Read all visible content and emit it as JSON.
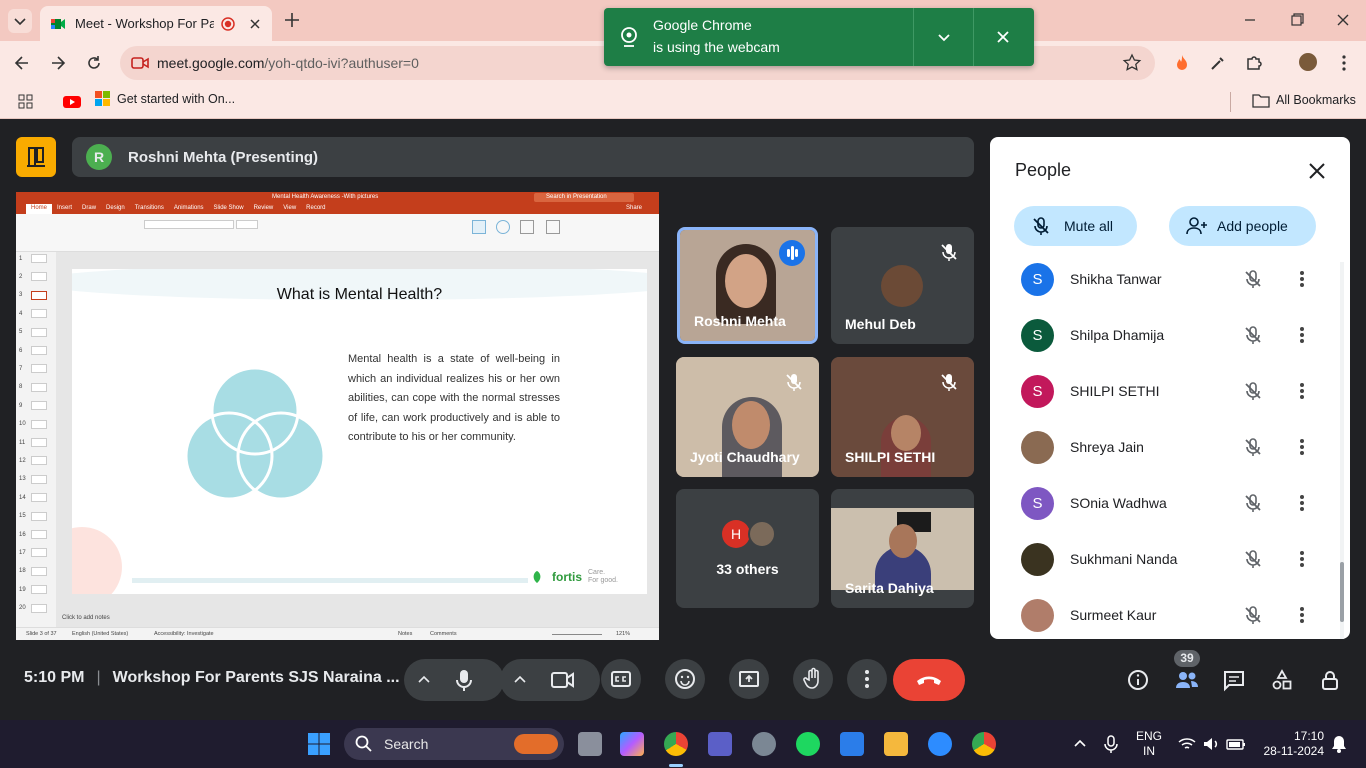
{
  "browser": {
    "tab_title": "Meet - Workshop For Paren",
    "url_host": "meet.google.com",
    "url_path": "/yoh-qtdo-ivi?authuser=0",
    "bookmark_1": "Get started with On...",
    "all_bookmarks": "All Bookmarks"
  },
  "notification": {
    "line1": "Google Chrome",
    "line2": "is using the webcam"
  },
  "presenter": {
    "initial": "R",
    "label": "Roshni Mehta (Presenting)"
  },
  "slide": {
    "doc_title": "Mental Health Awareness -With pictures",
    "search_placeholder": "Search in Presentation",
    "share_label": "Share",
    "ribbon_tabs": [
      "Home",
      "Insert",
      "Draw",
      "Design",
      "Transitions",
      "Animations",
      "Slide Show",
      "Review",
      "View",
      "Record"
    ],
    "heading": "What is Mental Health?",
    "body": "Mental health is a state of well-being in which an individual realizes his or her own abilities, can cope with the normal stresses of life, can work productively and is able to contribute to his or her community.",
    "notes_prompt": "Click to add notes",
    "status_left": "Slide 3 of 37",
    "status_lang": "English (United States)",
    "status_access": "Accessibility: Investigate",
    "status_notes": "Notes",
    "status_comments": "Comments",
    "zoom": "121%",
    "logo_text": "fortis",
    "logo_tag_1": "Care.",
    "logo_tag_2": "For good.",
    "thumb_numbers": [
      "1",
      "2",
      "3",
      "4",
      "5",
      "6",
      "7",
      "8",
      "9",
      "10",
      "11",
      "12",
      "13",
      "14",
      "15",
      "16",
      "17",
      "18",
      "19",
      "20"
    ]
  },
  "tiles": [
    {
      "name": "Roshni Mehta",
      "speaking": true
    },
    {
      "name": "Mehul Deb",
      "muted": true
    },
    {
      "name": "Jyoti Chaudhary",
      "muted": true
    },
    {
      "name": "SHILPI SETHI",
      "muted": true
    },
    {
      "name": "33 others",
      "avatar_initial": "H"
    },
    {
      "name": "Sarita Dahiya"
    }
  ],
  "people_panel": {
    "title": "People",
    "mute_all": "Mute all",
    "add_people": "Add people",
    "members": [
      {
        "name": "Shikha Tanwar",
        "initial": "S",
        "color": "#1a73e8"
      },
      {
        "name": "Shilpa Dhamija",
        "initial": "S",
        "color": "#0b5a3c"
      },
      {
        "name": "SHILPI SETHI",
        "initial": "S",
        "color": "#c2185b"
      },
      {
        "name": "Shreya Jain",
        "initial": "",
        "color": "#8a6a52"
      },
      {
        "name": "SOnia Wadhwa",
        "initial": "S",
        "color": "#7e57c2"
      },
      {
        "name": "Sukhmani Nanda",
        "initial": "",
        "color": "#3a3320"
      },
      {
        "name": "Surmeet Kaur",
        "initial": "",
        "color": "#b07d6a"
      }
    ]
  },
  "controls": {
    "time": "5:10 PM",
    "meeting_title": "Workshop For Parents SJS Naraina ...",
    "people_count": "39"
  },
  "taskbar": {
    "search": "Search",
    "lang_1": "ENG",
    "lang_2": "IN",
    "clock_time": "17:10",
    "clock_date": "28-11-2024"
  }
}
